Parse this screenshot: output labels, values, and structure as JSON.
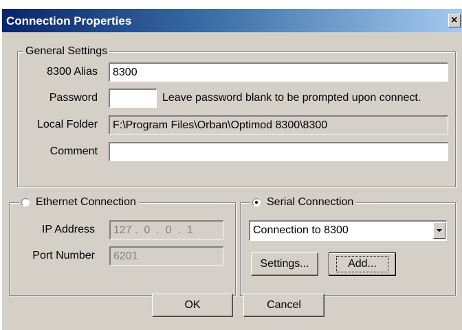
{
  "window": {
    "title": "Connection Properties",
    "close_glyph": "×"
  },
  "general": {
    "legend": "General Settings",
    "alias_label": "8300 Alias",
    "alias_value": "8300",
    "password_label": "Password",
    "password_value": "",
    "password_note": "Leave password blank to be prompted upon connect.",
    "folder_label": "Local Folder",
    "folder_value": "F:\\Program Files\\Orban\\Optimod 8300\\8300",
    "comment_label": "Comment",
    "comment_value": ""
  },
  "ethernet": {
    "legend": "Ethernet Connection",
    "selected": false,
    "ip_label": "IP Address",
    "ip_value": "127 .  0  .  0  .  1",
    "port_label": "Port Number",
    "port_value": "6201"
  },
  "serial": {
    "legend": "Serial Connection",
    "selected": true,
    "selected_connection": "Connection to 8300",
    "settings_label": "Settings...",
    "add_label": "Add..."
  },
  "footer": {
    "ok_label": "OK",
    "cancel_label": "Cancel"
  },
  "colors": {
    "face": "#d4d0c8",
    "title_start": "#0a246a",
    "title_end": "#a6caf0",
    "disabled_text": "#808080"
  }
}
